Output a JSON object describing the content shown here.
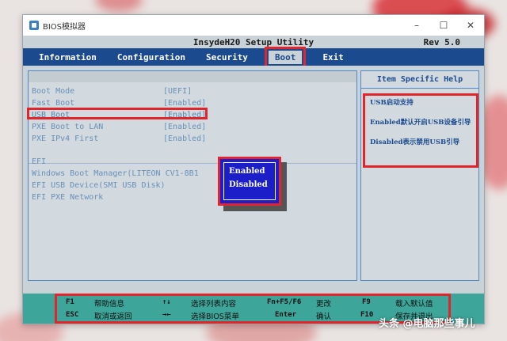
{
  "window": {
    "title": "BIOS模拟器",
    "controls": [
      "–",
      "☐",
      "✕"
    ]
  },
  "bios": {
    "title": "InsydeH20 Setup Utility",
    "rev": "Rev 5.0",
    "menu": [
      "Information",
      "Configuration",
      "Security",
      "Boot",
      "Exit"
    ],
    "active_menu": "Boot",
    "options": [
      {
        "label": "Boot Mode",
        "value": "[UEFI]"
      },
      {
        "label": "Fast Boot",
        "value": "[Enabled]"
      },
      {
        "label": "USB Boot",
        "value": "[Enabled]"
      },
      {
        "label": "PXE Boot to LAN",
        "value": "[Enabled]"
      },
      {
        "label": "PXE IPv4 First",
        "value": "[Enabled]"
      }
    ],
    "efi_heading": "EFI",
    "efi_items": [
      "Windows Boot Manager(LITEON CV1-8B1",
      "EFI USB Device(SMI USB Disk)",
      "EFI PXE Network"
    ],
    "popup_options": [
      "Enabled",
      "Disabled"
    ],
    "help": {
      "title": "Item Specific Help",
      "lines": [
        "USB启动支持",
        "Enabled默认开启USB设备引导",
        "Disabled表示禁用USB引导"
      ]
    },
    "footer": [
      {
        "key": "F1",
        "desc": "帮助信息"
      },
      {
        "key": "↑↓",
        "desc": "选择列表内容"
      },
      {
        "key": "Fn+F5/F6",
        "desc": "更改"
      },
      {
        "key": "F9",
        "desc": "载入默认值"
      },
      {
        "key": "ESC",
        "desc": "取消或返回"
      },
      {
        "key": "→←",
        "desc": "选择BIOS菜单"
      },
      {
        "key": "Enter",
        "desc": "确认"
      },
      {
        "key": "F10",
        "desc": "保存并退出"
      }
    ]
  },
  "watermark": "头条 @电脑那些事儿",
  "colors": {
    "menubar": "#1c4a8f",
    "highlight": "#e0262a",
    "popup": "#1c1fc9",
    "footer": "#3ea59a"
  }
}
